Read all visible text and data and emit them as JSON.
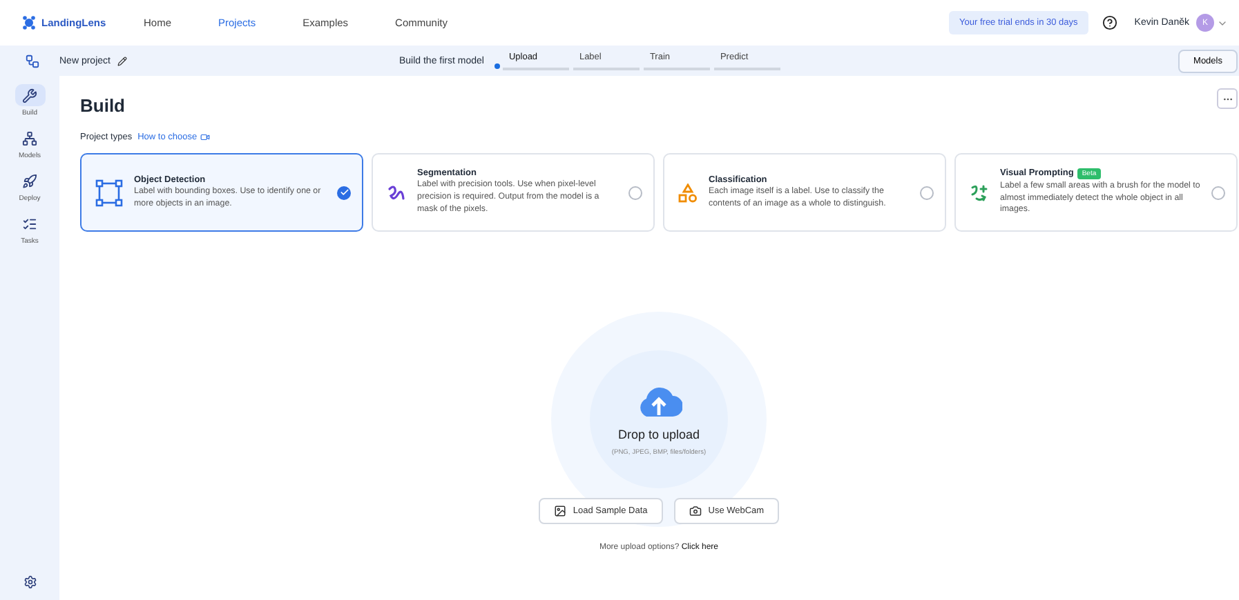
{
  "brand": {
    "name": "LandingLens"
  },
  "nav": [
    {
      "label": "Home",
      "selected": false
    },
    {
      "label": "Projects",
      "selected": true
    },
    {
      "label": "Examples",
      "selected": false
    },
    {
      "label": "Community",
      "selected": false
    }
  ],
  "trial_badge": "Your free trial ends in 30 days",
  "user": {
    "name": "Kevin Daněk",
    "initial": "K"
  },
  "project": {
    "name": "New project"
  },
  "stepper": {
    "title": "Build the first model",
    "steps": [
      {
        "label": "Upload",
        "selected": true
      },
      {
        "label": "Label",
        "selected": false
      },
      {
        "label": "Train",
        "selected": false
      },
      {
        "label": "Predict",
        "selected": false
      }
    ]
  },
  "models_button": "Models",
  "sidebar": {
    "items": [
      {
        "kind": "build",
        "label": "Build",
        "selected": true
      },
      {
        "kind": "models",
        "label": "Models",
        "selected": false
      },
      {
        "kind": "deploy",
        "label": "Deploy",
        "selected": false
      },
      {
        "kind": "tasks",
        "label": "Tasks",
        "selected": false
      }
    ]
  },
  "page": {
    "title": "Build",
    "project_types_label": "Project types",
    "how_to_choose": "How to choose"
  },
  "project_types": [
    {
      "kind": "detection",
      "title": "Object Detection",
      "description": "Label with bounding boxes. Use to identify one or more objects in an image.",
      "selected": true
    },
    {
      "kind": "segmentation",
      "title": "Segmentation",
      "description": "Label with precision tools. Use when pixel-level precision is required. Output from the model is a mask of the pixels.",
      "selected": false
    },
    {
      "kind": "classification",
      "title": "Classification",
      "description": "Each image itself is a label. Use to classify the contents of an image as a whole to distinguish.",
      "selected": false
    },
    {
      "kind": "prompting",
      "title": "Visual Prompting",
      "badge": "Beta",
      "description": "Label a few small areas with a brush for the model to almost immediately detect the whole object in all images.",
      "selected": false
    }
  ],
  "upload": {
    "title": "Drop to upload",
    "formats": "(PNG, JPEG, BMP, files/folders)",
    "buttons": [
      {
        "kind": "sample",
        "label": "Load Sample Data"
      },
      {
        "kind": "webcam",
        "label": "Use WebCam"
      }
    ],
    "more_text": "More upload options?",
    "more_link": "Click here"
  }
}
